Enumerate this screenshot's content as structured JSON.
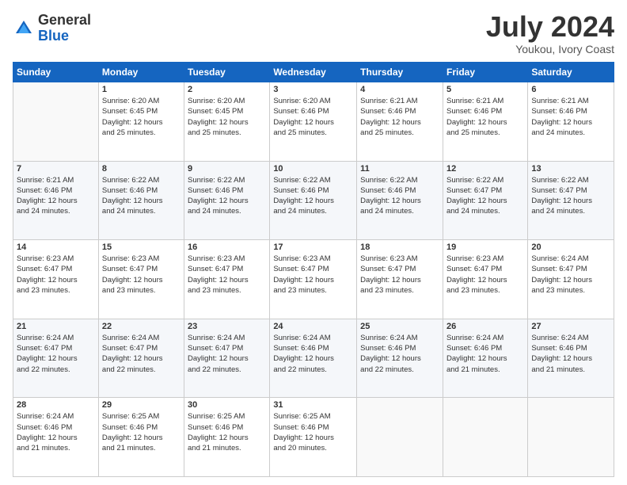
{
  "logo": {
    "general": "General",
    "blue": "Blue"
  },
  "title": "July 2024",
  "location": "Youkou, Ivory Coast",
  "headers": [
    "Sunday",
    "Monday",
    "Tuesday",
    "Wednesday",
    "Thursday",
    "Friday",
    "Saturday"
  ],
  "weeks": [
    [
      {
        "num": "",
        "info": ""
      },
      {
        "num": "1",
        "info": "Sunrise: 6:20 AM\nSunset: 6:45 PM\nDaylight: 12 hours\nand 25 minutes."
      },
      {
        "num": "2",
        "info": "Sunrise: 6:20 AM\nSunset: 6:45 PM\nDaylight: 12 hours\nand 25 minutes."
      },
      {
        "num": "3",
        "info": "Sunrise: 6:20 AM\nSunset: 6:46 PM\nDaylight: 12 hours\nand 25 minutes."
      },
      {
        "num": "4",
        "info": "Sunrise: 6:21 AM\nSunset: 6:46 PM\nDaylight: 12 hours\nand 25 minutes."
      },
      {
        "num": "5",
        "info": "Sunrise: 6:21 AM\nSunset: 6:46 PM\nDaylight: 12 hours\nand 25 minutes."
      },
      {
        "num": "6",
        "info": "Sunrise: 6:21 AM\nSunset: 6:46 PM\nDaylight: 12 hours\nand 24 minutes."
      }
    ],
    [
      {
        "num": "7",
        "info": "Sunrise: 6:21 AM\nSunset: 6:46 PM\nDaylight: 12 hours\nand 24 minutes."
      },
      {
        "num": "8",
        "info": "Sunrise: 6:22 AM\nSunset: 6:46 PM\nDaylight: 12 hours\nand 24 minutes."
      },
      {
        "num": "9",
        "info": "Sunrise: 6:22 AM\nSunset: 6:46 PM\nDaylight: 12 hours\nand 24 minutes."
      },
      {
        "num": "10",
        "info": "Sunrise: 6:22 AM\nSunset: 6:46 PM\nDaylight: 12 hours\nand 24 minutes."
      },
      {
        "num": "11",
        "info": "Sunrise: 6:22 AM\nSunset: 6:46 PM\nDaylight: 12 hours\nand 24 minutes."
      },
      {
        "num": "12",
        "info": "Sunrise: 6:22 AM\nSunset: 6:47 PM\nDaylight: 12 hours\nand 24 minutes."
      },
      {
        "num": "13",
        "info": "Sunrise: 6:22 AM\nSunset: 6:47 PM\nDaylight: 12 hours\nand 24 minutes."
      }
    ],
    [
      {
        "num": "14",
        "info": "Sunrise: 6:23 AM\nSunset: 6:47 PM\nDaylight: 12 hours\nand 23 minutes."
      },
      {
        "num": "15",
        "info": "Sunrise: 6:23 AM\nSunset: 6:47 PM\nDaylight: 12 hours\nand 23 minutes."
      },
      {
        "num": "16",
        "info": "Sunrise: 6:23 AM\nSunset: 6:47 PM\nDaylight: 12 hours\nand 23 minutes."
      },
      {
        "num": "17",
        "info": "Sunrise: 6:23 AM\nSunset: 6:47 PM\nDaylight: 12 hours\nand 23 minutes."
      },
      {
        "num": "18",
        "info": "Sunrise: 6:23 AM\nSunset: 6:47 PM\nDaylight: 12 hours\nand 23 minutes."
      },
      {
        "num": "19",
        "info": "Sunrise: 6:23 AM\nSunset: 6:47 PM\nDaylight: 12 hours\nand 23 minutes."
      },
      {
        "num": "20",
        "info": "Sunrise: 6:24 AM\nSunset: 6:47 PM\nDaylight: 12 hours\nand 23 minutes."
      }
    ],
    [
      {
        "num": "21",
        "info": "Sunrise: 6:24 AM\nSunset: 6:47 PM\nDaylight: 12 hours\nand 22 minutes."
      },
      {
        "num": "22",
        "info": "Sunrise: 6:24 AM\nSunset: 6:47 PM\nDaylight: 12 hours\nand 22 minutes."
      },
      {
        "num": "23",
        "info": "Sunrise: 6:24 AM\nSunset: 6:47 PM\nDaylight: 12 hours\nand 22 minutes."
      },
      {
        "num": "24",
        "info": "Sunrise: 6:24 AM\nSunset: 6:46 PM\nDaylight: 12 hours\nand 22 minutes."
      },
      {
        "num": "25",
        "info": "Sunrise: 6:24 AM\nSunset: 6:46 PM\nDaylight: 12 hours\nand 22 minutes."
      },
      {
        "num": "26",
        "info": "Sunrise: 6:24 AM\nSunset: 6:46 PM\nDaylight: 12 hours\nand 21 minutes."
      },
      {
        "num": "27",
        "info": "Sunrise: 6:24 AM\nSunset: 6:46 PM\nDaylight: 12 hours\nand 21 minutes."
      }
    ],
    [
      {
        "num": "28",
        "info": "Sunrise: 6:24 AM\nSunset: 6:46 PM\nDaylight: 12 hours\nand 21 minutes."
      },
      {
        "num": "29",
        "info": "Sunrise: 6:25 AM\nSunset: 6:46 PM\nDaylight: 12 hours\nand 21 minutes."
      },
      {
        "num": "30",
        "info": "Sunrise: 6:25 AM\nSunset: 6:46 PM\nDaylight: 12 hours\nand 21 minutes."
      },
      {
        "num": "31",
        "info": "Sunrise: 6:25 AM\nSunset: 6:46 PM\nDaylight: 12 hours\nand 20 minutes."
      },
      {
        "num": "",
        "info": ""
      },
      {
        "num": "",
        "info": ""
      },
      {
        "num": "",
        "info": ""
      }
    ]
  ]
}
